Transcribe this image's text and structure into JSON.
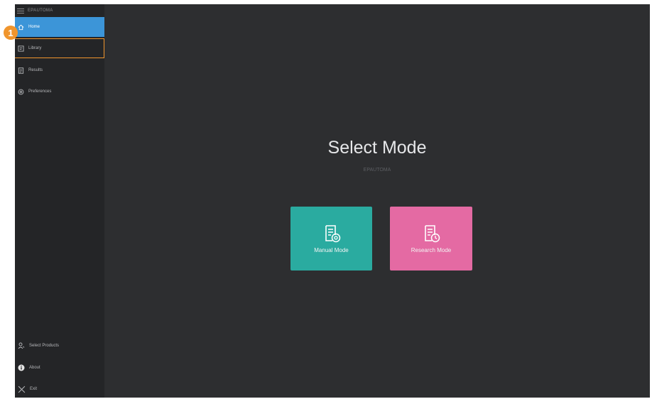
{
  "app": {
    "name": "EPAUTOMA"
  },
  "sidebar": {
    "items": [
      {
        "label": "Home",
        "icon": "home-icon",
        "active": true
      },
      {
        "label": "Library",
        "icon": "library-icon",
        "highlighted": true
      },
      {
        "label": "Results",
        "icon": "results-icon"
      },
      {
        "label": "Preferences",
        "icon": "preferences-icon"
      }
    ],
    "bottom_items": [
      {
        "label": "Select Products",
        "icon": "user-icon"
      },
      {
        "label": "About",
        "icon": "info-icon"
      },
      {
        "label": "Exit",
        "icon": "close-icon"
      }
    ]
  },
  "main": {
    "title": "Select Mode",
    "subtitle": "EPAUTOMA",
    "modes": [
      {
        "label": "Manual Mode",
        "icon": "manual-mode-icon",
        "color": "#2aaba0"
      },
      {
        "label": "Research Mode",
        "icon": "research-mode-icon",
        "color": "#e46aa3"
      }
    ]
  },
  "annotation": {
    "badge": "1",
    "color": "#f0952d"
  },
  "colors": {
    "accent": "#3c95d8",
    "background": "#2d2e30",
    "sidebar": "#242527"
  }
}
